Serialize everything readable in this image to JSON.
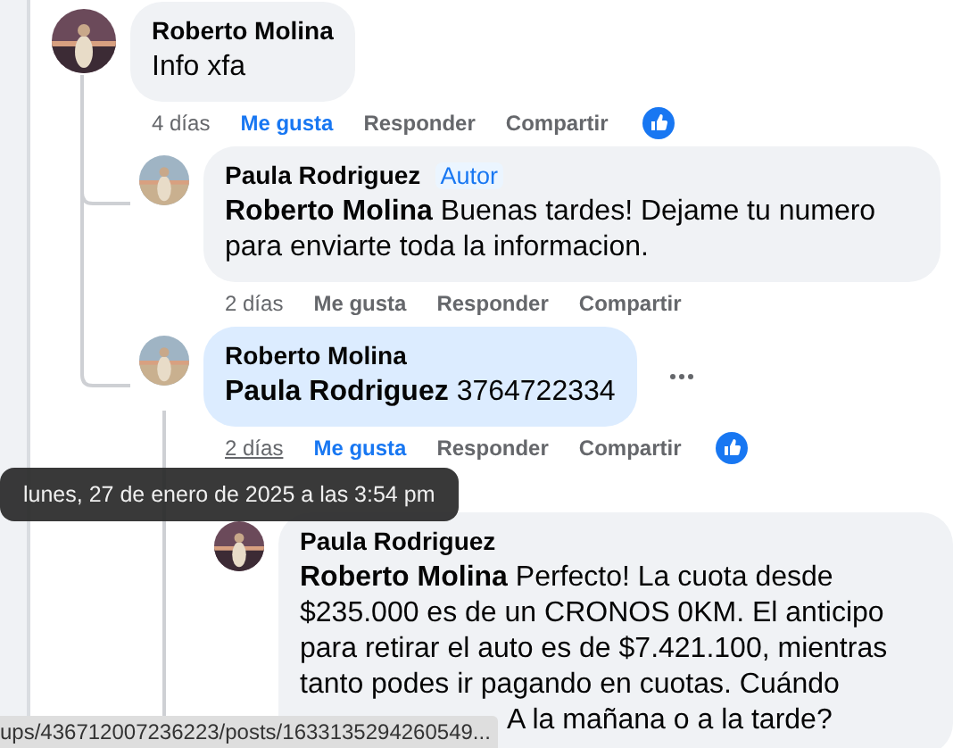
{
  "comments": [
    {
      "author": "Roberto Molina",
      "text": "Info xfa",
      "time": "4 días",
      "time_hovered": false,
      "like_label": "Me gusta",
      "liked": true,
      "reply_label": "Responder",
      "share_label": "Compartir",
      "has_reaction": true,
      "highlighted": false,
      "has_menu": false,
      "children": [
        {
          "author": "Paula Rodriguez",
          "badge": "Autor",
          "mention": "Roberto Molina",
          "text": "Buenas tardes! Dejame tu numero para enviarte toda la informacion.",
          "time": "2 días",
          "time_hovered": false,
          "like_label": "Me gusta",
          "liked": false,
          "reply_label": "Responder",
          "share_label": "Compartir",
          "has_reaction": false,
          "highlighted": false,
          "has_menu": false
        },
        {
          "author": "Roberto Molina",
          "mention": "Paula Rodriguez",
          "text": "3764722334",
          "time": "2 días",
          "time_hovered": true,
          "like_label": "Me gusta",
          "liked": true,
          "reply_label": "Responder",
          "share_label": "Compartir",
          "has_reaction": true,
          "highlighted": true,
          "has_menu": true,
          "children": [
            {
              "author": "Paula Rodriguez",
              "mention": "Roberto Molina",
              "text": "Perfecto! La cuota desde $235.000 es de un CRONOS 0KM. El anticipo para retirar el auto es de $7.421.100, mientras tanto podes ir pagando en cuotas. Cuándo",
              "text_continued": "A la mañana o a la tarde?",
              "highlighted": false,
              "has_menu": false
            }
          ]
        }
      ]
    }
  ],
  "tooltip": "lunes, 27 de enero de 2025 a las 3:54 pm",
  "status_bar": {
    "url": "ups/436712007236223/posts/1633135294260549..."
  }
}
